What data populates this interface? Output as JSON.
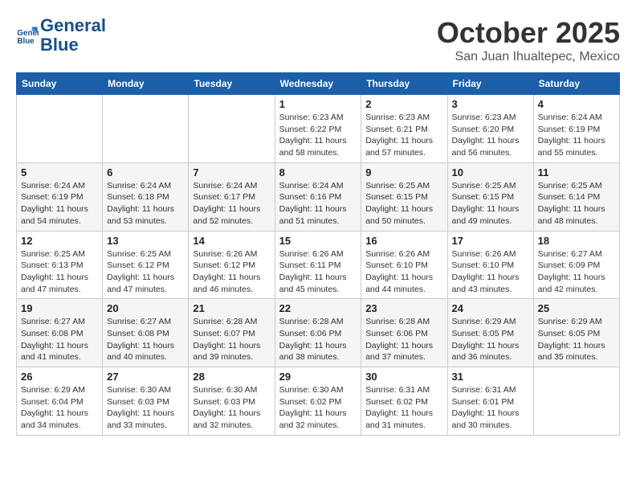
{
  "logo": {
    "line1": "General",
    "line2": "Blue"
  },
  "title": "October 2025",
  "location": "San Juan Ihualtepec, Mexico",
  "days_of_week": [
    "Sunday",
    "Monday",
    "Tuesday",
    "Wednesday",
    "Thursday",
    "Friday",
    "Saturday"
  ],
  "weeks": [
    [
      {
        "num": "",
        "info": ""
      },
      {
        "num": "",
        "info": ""
      },
      {
        "num": "",
        "info": ""
      },
      {
        "num": "1",
        "info": "Sunrise: 6:23 AM\nSunset: 6:22 PM\nDaylight: 11 hours\nand 58 minutes."
      },
      {
        "num": "2",
        "info": "Sunrise: 6:23 AM\nSunset: 6:21 PM\nDaylight: 11 hours\nand 57 minutes."
      },
      {
        "num": "3",
        "info": "Sunrise: 6:23 AM\nSunset: 6:20 PM\nDaylight: 11 hours\nand 56 minutes."
      },
      {
        "num": "4",
        "info": "Sunrise: 6:24 AM\nSunset: 6:19 PM\nDaylight: 11 hours\nand 55 minutes."
      }
    ],
    [
      {
        "num": "5",
        "info": "Sunrise: 6:24 AM\nSunset: 6:19 PM\nDaylight: 11 hours\nand 54 minutes."
      },
      {
        "num": "6",
        "info": "Sunrise: 6:24 AM\nSunset: 6:18 PM\nDaylight: 11 hours\nand 53 minutes."
      },
      {
        "num": "7",
        "info": "Sunrise: 6:24 AM\nSunset: 6:17 PM\nDaylight: 11 hours\nand 52 minutes."
      },
      {
        "num": "8",
        "info": "Sunrise: 6:24 AM\nSunset: 6:16 PM\nDaylight: 11 hours\nand 51 minutes."
      },
      {
        "num": "9",
        "info": "Sunrise: 6:25 AM\nSunset: 6:15 PM\nDaylight: 11 hours\nand 50 minutes."
      },
      {
        "num": "10",
        "info": "Sunrise: 6:25 AM\nSunset: 6:15 PM\nDaylight: 11 hours\nand 49 minutes."
      },
      {
        "num": "11",
        "info": "Sunrise: 6:25 AM\nSunset: 6:14 PM\nDaylight: 11 hours\nand 48 minutes."
      }
    ],
    [
      {
        "num": "12",
        "info": "Sunrise: 6:25 AM\nSunset: 6:13 PM\nDaylight: 11 hours\nand 47 minutes."
      },
      {
        "num": "13",
        "info": "Sunrise: 6:25 AM\nSunset: 6:12 PM\nDaylight: 11 hours\nand 47 minutes."
      },
      {
        "num": "14",
        "info": "Sunrise: 6:26 AM\nSunset: 6:12 PM\nDaylight: 11 hours\nand 46 minutes."
      },
      {
        "num": "15",
        "info": "Sunrise: 6:26 AM\nSunset: 6:11 PM\nDaylight: 11 hours\nand 45 minutes."
      },
      {
        "num": "16",
        "info": "Sunrise: 6:26 AM\nSunset: 6:10 PM\nDaylight: 11 hours\nand 44 minutes."
      },
      {
        "num": "17",
        "info": "Sunrise: 6:26 AM\nSunset: 6:10 PM\nDaylight: 11 hours\nand 43 minutes."
      },
      {
        "num": "18",
        "info": "Sunrise: 6:27 AM\nSunset: 6:09 PM\nDaylight: 11 hours\nand 42 minutes."
      }
    ],
    [
      {
        "num": "19",
        "info": "Sunrise: 6:27 AM\nSunset: 6:08 PM\nDaylight: 11 hours\nand 41 minutes."
      },
      {
        "num": "20",
        "info": "Sunrise: 6:27 AM\nSunset: 6:08 PM\nDaylight: 11 hours\nand 40 minutes."
      },
      {
        "num": "21",
        "info": "Sunrise: 6:28 AM\nSunset: 6:07 PM\nDaylight: 11 hours\nand 39 minutes."
      },
      {
        "num": "22",
        "info": "Sunrise: 6:28 AM\nSunset: 6:06 PM\nDaylight: 11 hours\nand 38 minutes."
      },
      {
        "num": "23",
        "info": "Sunrise: 6:28 AM\nSunset: 6:06 PM\nDaylight: 11 hours\nand 37 minutes."
      },
      {
        "num": "24",
        "info": "Sunrise: 6:29 AM\nSunset: 6:05 PM\nDaylight: 11 hours\nand 36 minutes."
      },
      {
        "num": "25",
        "info": "Sunrise: 6:29 AM\nSunset: 6:05 PM\nDaylight: 11 hours\nand 35 minutes."
      }
    ],
    [
      {
        "num": "26",
        "info": "Sunrise: 6:29 AM\nSunset: 6:04 PM\nDaylight: 11 hours\nand 34 minutes."
      },
      {
        "num": "27",
        "info": "Sunrise: 6:30 AM\nSunset: 6:03 PM\nDaylight: 11 hours\nand 33 minutes."
      },
      {
        "num": "28",
        "info": "Sunrise: 6:30 AM\nSunset: 6:03 PM\nDaylight: 11 hours\nand 32 minutes."
      },
      {
        "num": "29",
        "info": "Sunrise: 6:30 AM\nSunset: 6:02 PM\nDaylight: 11 hours\nand 32 minutes."
      },
      {
        "num": "30",
        "info": "Sunrise: 6:31 AM\nSunset: 6:02 PM\nDaylight: 11 hours\nand 31 minutes."
      },
      {
        "num": "31",
        "info": "Sunrise: 6:31 AM\nSunset: 6:01 PM\nDaylight: 11 hours\nand 30 minutes."
      },
      {
        "num": "",
        "info": ""
      }
    ]
  ]
}
